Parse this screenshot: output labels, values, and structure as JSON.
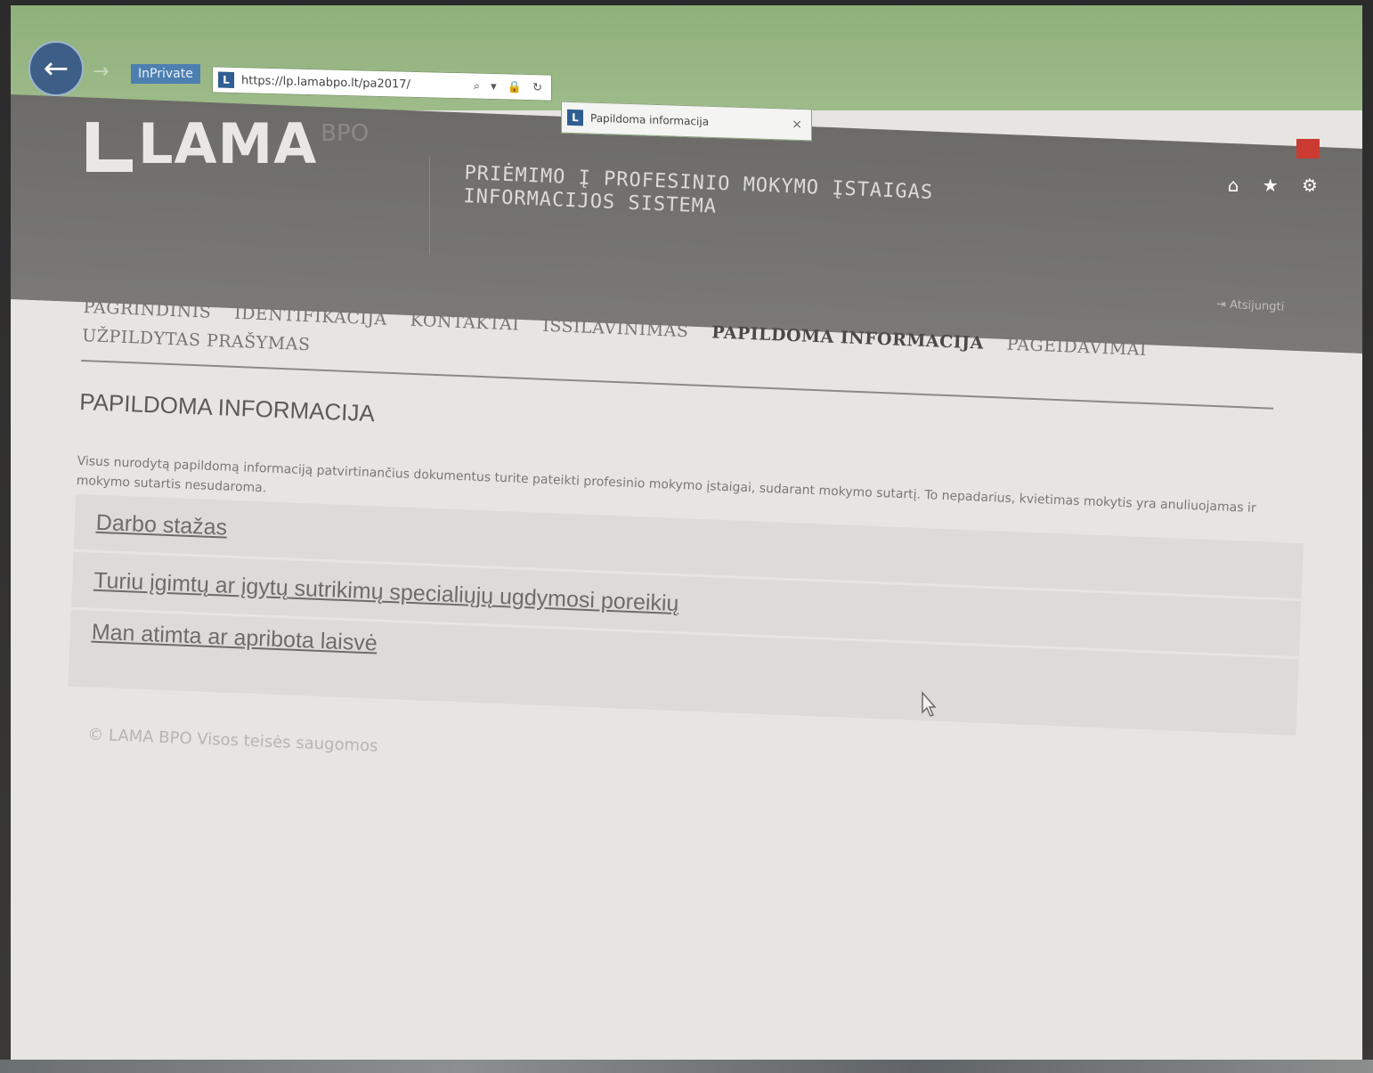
{
  "browser": {
    "mode_label": "InPrivate",
    "url": "https://lp.lamabpo.lt/pa2017/",
    "address_icons": "⌕ ▾ 🔒 ↻",
    "tab_title": "Papildoma informacija",
    "tab_close": "×",
    "toolbar_icons": "⌂ ★ ⚙"
  },
  "header": {
    "logo_text": "LAMA",
    "logo_superscript": "BPO",
    "logo_tagline": "",
    "system_title_line1": "PRIĖMIMO Į PROFESINIO MOKYMO ĮSTAIGAS",
    "system_title_line2": "INFORMACIJOS SISTEMA",
    "user_name": "",
    "logout_label": "Atsijungti"
  },
  "nav": {
    "items": [
      {
        "label": "PAGRINDINIS",
        "active": false
      },
      {
        "label": "IDENTIFIKACIJA",
        "active": false
      },
      {
        "label": "KONTAKTAI",
        "active": false
      },
      {
        "label": "IŠSILAVINIMAS",
        "active": false
      },
      {
        "label": "PAPILDOMA INFORMACIJA",
        "active": true
      },
      {
        "label": "PAGEIDAVIMAI",
        "active": false
      },
      {
        "label": "UŽPILDYTAS PRAŠYMAS",
        "active": false
      }
    ]
  },
  "main": {
    "heading": "PAPILDOMA INFORMACIJA",
    "intro": "Visus nurodytą papildomą informaciją patvirtinančius dokumentus turite pateikti profesinio mokymo įstaigai, sudarant mokymo sutartį. To nepadarius, kvietimas mokytis yra anuliuojamas ir mokymo sutartis nesudaroma.",
    "sections": [
      {
        "label": "Darbo stažas"
      },
      {
        "label": "Turiu įgimtų ar įgytų sutrikimų specialiųjų ugdymosi poreikių"
      },
      {
        "label": "Man atimta ar apribota laisvė"
      }
    ]
  },
  "footer": {
    "copyright": "© LAMA BPO Visos teisės saugomos"
  },
  "colors": {
    "chrome_green": "#9ebb8a",
    "header_gray": "#727170",
    "accent_blue": "#3d5e86",
    "close_red": "#cc3b32"
  }
}
